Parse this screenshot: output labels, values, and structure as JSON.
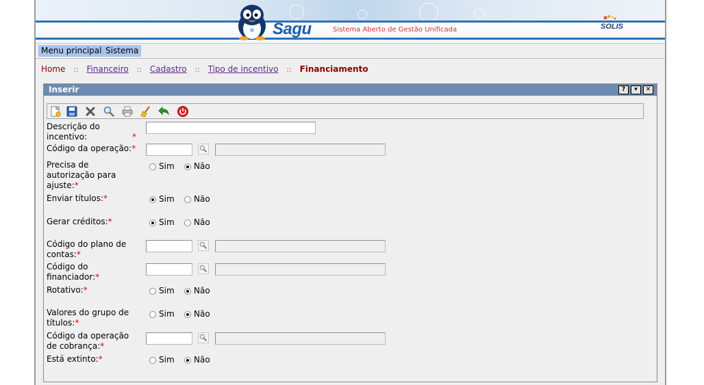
{
  "app": {
    "logo": "Sagu",
    "subtitle": "Sistema Aberto de Gestão Unificada",
    "vendor": "SOLIS"
  },
  "menu": [
    {
      "label": "Menu principal"
    },
    {
      "label": "Sistema"
    }
  ],
  "breadcrumb": {
    "home": "Home",
    "items": [
      "Financeiro",
      "Cadastro",
      "Tipo de incentivo"
    ],
    "separator": "::",
    "current": "Financiamento"
  },
  "panel": {
    "title": "Inserir",
    "buttons": {
      "help": "?",
      "minimize": "▾",
      "close": "✕"
    }
  },
  "toolbar": [
    {
      "icon": "new-icon"
    },
    {
      "icon": "save-icon"
    },
    {
      "icon": "delete-icon"
    },
    {
      "icon": "search-icon"
    },
    {
      "icon": "print-icon"
    },
    {
      "icon": "clear-icon"
    },
    {
      "icon": "back-icon"
    },
    {
      "icon": "exit-icon"
    }
  ],
  "form": {
    "required_mark": "*",
    "yes": "Sim",
    "no": "Não",
    "fields": {
      "descricao": {
        "label": "Descrição do incentivo:",
        "value": ""
      },
      "codigo_operacao": {
        "label": "Código da operação:",
        "value": "",
        "description": ""
      },
      "precisa_autorizacao": {
        "label": "Precisa de autorização para ajuste:",
        "value": "Não"
      },
      "enviar_titulos": {
        "label": "Enviar títulos:",
        "value": "Sim"
      },
      "gerar_creditos": {
        "label": "Gerar créditos:",
        "value": "Sim"
      },
      "codigo_plano_contas": {
        "label": "Código do plano de contas:",
        "value": "",
        "description": ""
      },
      "codigo_financiador": {
        "label": "Código do financiador:",
        "value": "",
        "description": ""
      },
      "rotativo": {
        "label": "Rotativo:",
        "value": "Não"
      },
      "valores_grupo_titulos": {
        "label": "Valores do grupo de títulos:",
        "value": "Não"
      },
      "codigo_operacao_cobranca": {
        "label": "Código da operação de cobrança:",
        "value": "",
        "description": ""
      },
      "esta_extinto": {
        "label": "Está extinto:",
        "value": "Não"
      }
    }
  },
  "colors": {
    "title_bar": "#6d8bb0",
    "menu_item": "#a9c4ee",
    "brand_blue": "#1d5ea8",
    "required": "#e00000"
  }
}
